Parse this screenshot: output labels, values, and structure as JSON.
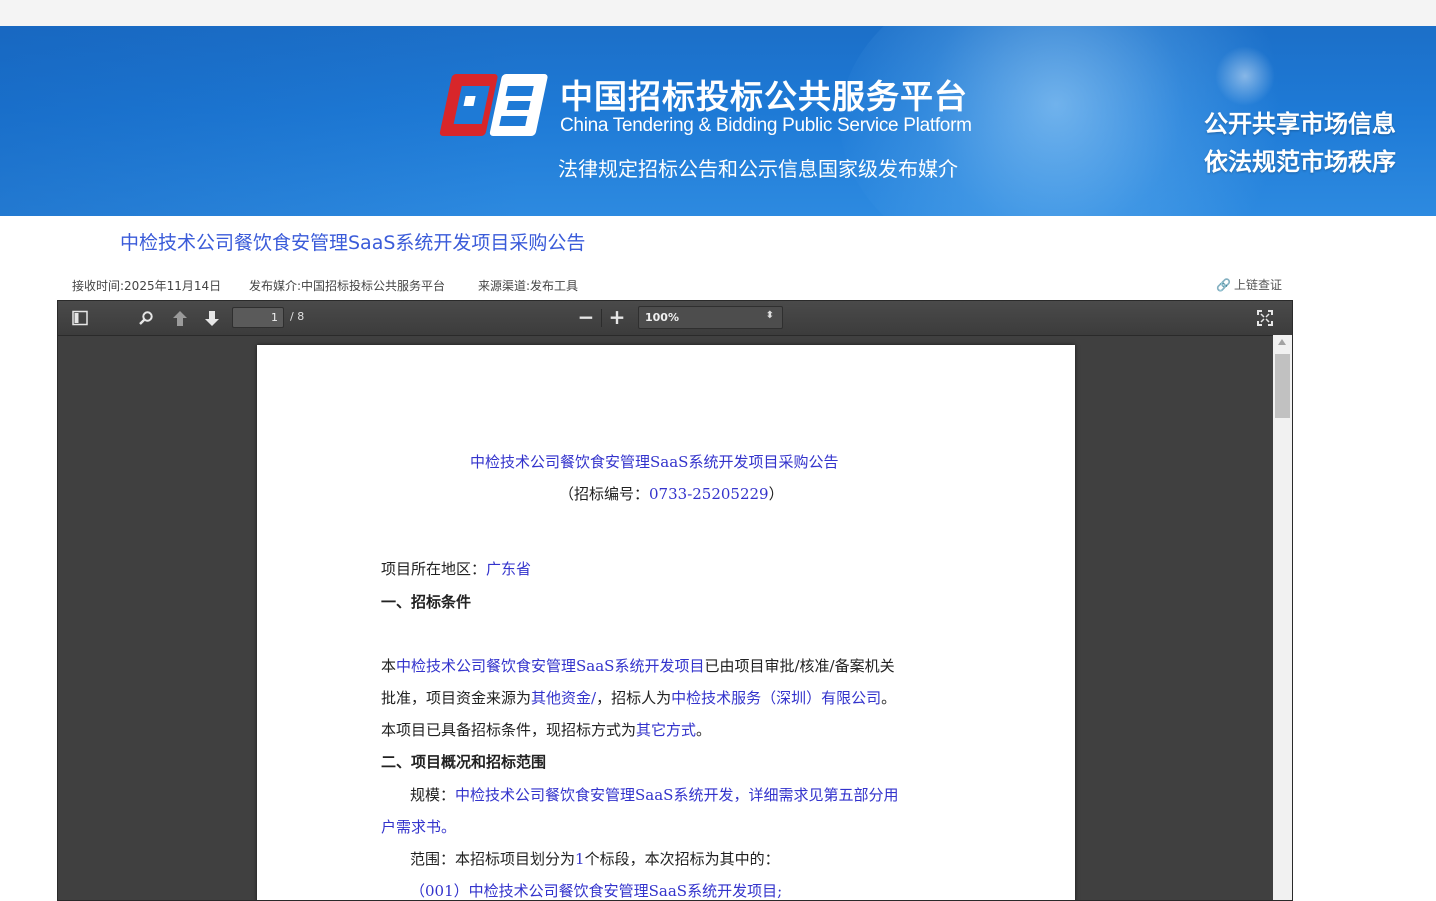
{
  "banner": {
    "brand_cn": "中国招标投标公共服务平台",
    "brand_en": "China Tendering & Bidding Public Service Platform",
    "slogan": "法律规定招标公告和公示信息国家级发布媒介",
    "motto_line1": "公开共享市场信息",
    "motto_line2": "依法规范市场秩序",
    "logo_icon": "cebpubservice-logo-icon"
  },
  "header": {
    "title": "中检技术公司餐饮食安管理SaaS系统开发项目采购公告"
  },
  "meta": {
    "received": "接收时间:2025年11月14日",
    "media": "发布媒介:中国招标投标公共服务平台",
    "channel": "来源渠道:发布工具",
    "verify_label": "上链查证"
  },
  "viewer": {
    "page_current": "1",
    "page_total": "/ 8",
    "zoom": "100%",
    "zoom_out": "−",
    "zoom_in": "+"
  },
  "document": {
    "title": "中检技术公司餐饮食安管理SaaS系统开发项目采购公告",
    "code_prefix": "（招标编号：",
    "code_value": "0733-25205229",
    "code_suffix": "）",
    "region_label": "项目所在地区：",
    "region_value": "广东省",
    "section1_heading": "一、招标条件",
    "p1_a": "本",
    "p1_b": "中检技术公司餐饮食安管理SaaS系统开发项目",
    "p1_c": "已由项目审批/核准/备案机关",
    "p2_a": "批准，项目资金来源为",
    "p2_b": "其他资金/",
    "p2_c": "，招标人为",
    "p2_d": "中检技术服务（深圳）有限公司",
    "p2_e": "。",
    "p3_a": "本项目已具备招标条件，现招标方式为",
    "p3_b": "其它方式",
    "p3_c": "。",
    "section2_heading": "二、项目概况和招标范围",
    "scale_label": "规模：",
    "scale_value_1": "中检技术公司餐饮食安管理SaaS系统开发，详细需求见第五部分用",
    "scale_value_2": "户需求书。",
    "scope_a": "范围：本招标项目划分为",
    "scope_b": "1",
    "scope_c": "个标段，本次招标为其中的：",
    "lot": "（001）中检技术公司餐饮食安管理SaaS系统开发项目;"
  },
  "colors": {
    "accent_blue": "#3a5bd9",
    "doc_link_blue": "#3333cc",
    "banner_blue": "#1e7ad6",
    "viewer_bg": "#404040"
  }
}
